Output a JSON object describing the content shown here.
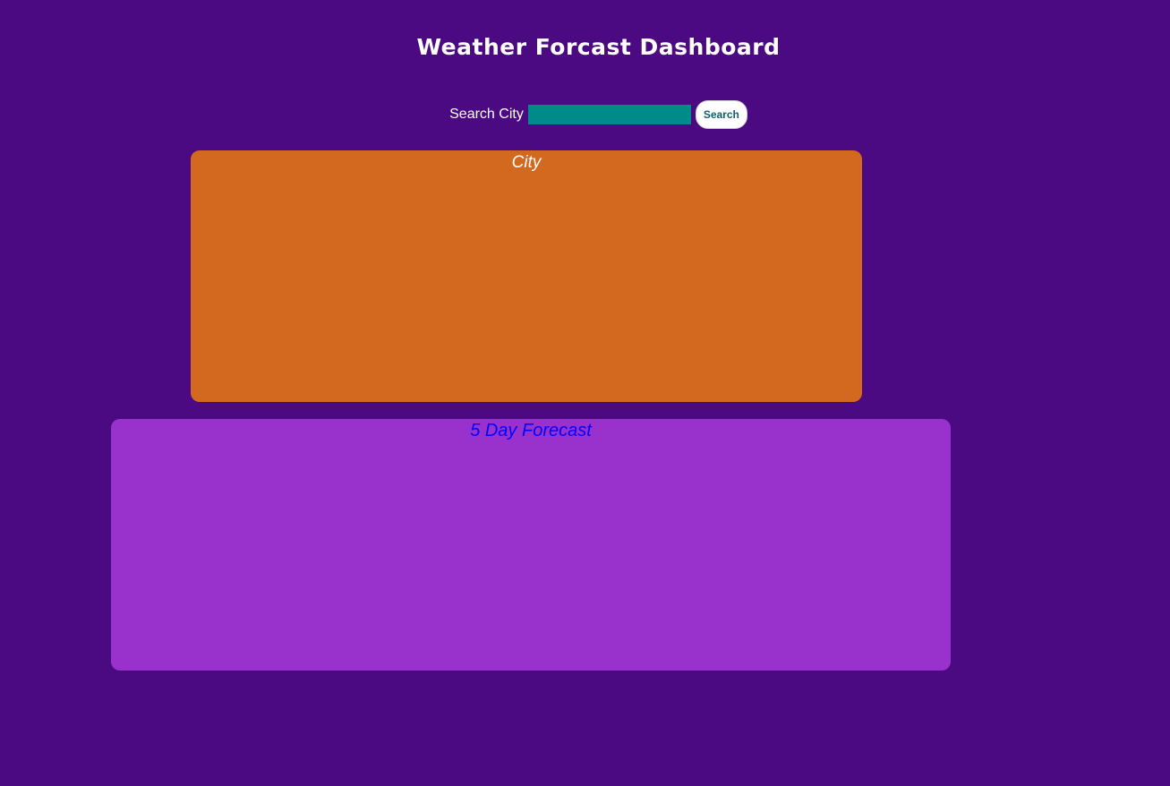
{
  "header": {
    "title": "Weather Forcast Dashboard"
  },
  "search": {
    "label": "Search City",
    "value": "",
    "placeholder": "",
    "button_label": "Search"
  },
  "city_panel": {
    "heading": "City"
  },
  "forecast_panel": {
    "heading": "5 Day Forecast"
  },
  "colors": {
    "background": "#4b0a82",
    "city_panel": "#d2691e",
    "forecast_panel": "#9932cc",
    "search_input": "#008b8b",
    "forecast_heading": "#0000ff"
  }
}
